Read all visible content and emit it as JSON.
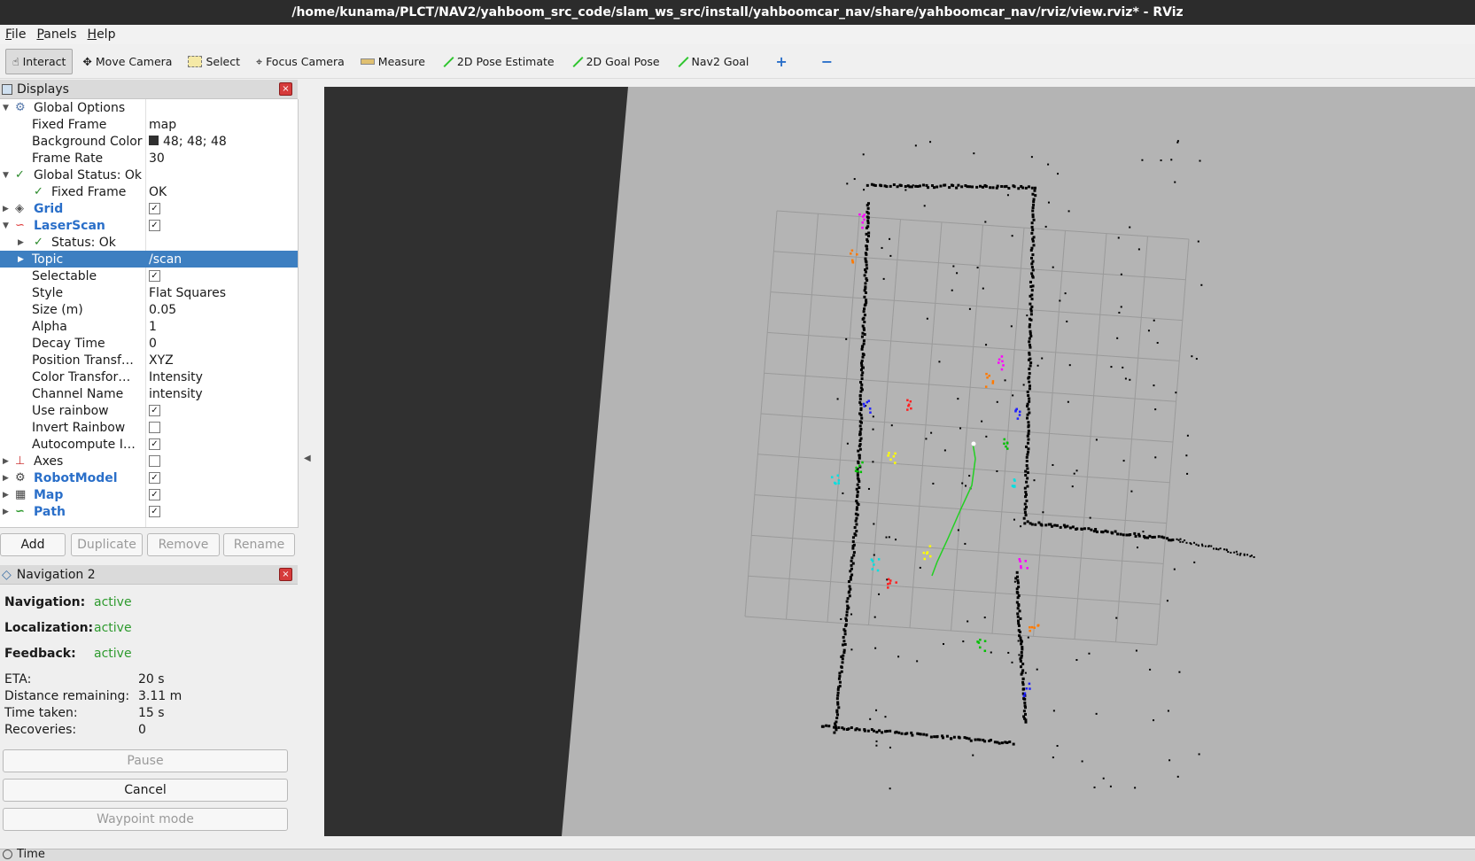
{
  "window": {
    "title": "/home/kunama/PLCT/NAV2/yahboom_src_code/slam_ws_src/install/yahboomcar_nav/share/yahboomcar_nav/rviz/view.rviz* - RViz"
  },
  "menu": [
    "File",
    "Panels",
    "Help"
  ],
  "toolbar": {
    "interact": "Interact",
    "move_camera": "Move Camera",
    "select": "Select",
    "focus_camera": "Focus Camera",
    "measure": "Measure",
    "pose_estimate": "2D Pose Estimate",
    "goal_pose": "2D Goal Pose",
    "nav2_goal": "Nav2 Goal"
  },
  "displays": {
    "title": "Displays",
    "rows": [
      {
        "label": "Global Options",
        "value": ""
      },
      {
        "label": "Fixed Frame",
        "value": "map"
      },
      {
        "label": "Background Color",
        "value": "48; 48; 48"
      },
      {
        "label": "Frame Rate",
        "value": "30"
      },
      {
        "label": "Global Status: Ok",
        "value": ""
      },
      {
        "label": "Fixed Frame",
        "value": "OK"
      },
      {
        "label": "Grid",
        "value": ""
      },
      {
        "label": "LaserScan",
        "value": ""
      },
      {
        "label": "Status: Ok",
        "value": ""
      },
      {
        "label": "Topic",
        "value": "/scan"
      },
      {
        "label": "Selectable",
        "value": ""
      },
      {
        "label": "Style",
        "value": "Flat Squares"
      },
      {
        "label": "Size (m)",
        "value": "0.05"
      },
      {
        "label": "Alpha",
        "value": "1"
      },
      {
        "label": "Decay Time",
        "value": "0"
      },
      {
        "label": "Position Transf…",
        "value": "XYZ"
      },
      {
        "label": "Color Transfor…",
        "value": "Intensity"
      },
      {
        "label": "Channel Name",
        "value": "intensity"
      },
      {
        "label": "Use rainbow",
        "value": ""
      },
      {
        "label": "Invert Rainbow",
        "value": ""
      },
      {
        "label": "Autocompute I…",
        "value": ""
      },
      {
        "label": "Axes",
        "value": ""
      },
      {
        "label": "RobotModel",
        "value": ""
      },
      {
        "label": "Map",
        "value": ""
      },
      {
        "label": "Path",
        "value": ""
      }
    ],
    "buttons": {
      "add": "Add",
      "duplicate": "Duplicate",
      "remove": "Remove",
      "rename": "Rename"
    }
  },
  "nav2": {
    "title": "Navigation 2",
    "navigation_label": "Navigation:",
    "navigation_value": "active",
    "localization_label": "Localization:",
    "localization_value": "active",
    "feedback_label": "Feedback:",
    "feedback_value": "active",
    "eta_label": "ETA:",
    "eta_value": "20 s",
    "distance_label": "Distance remaining:",
    "distance_value": "3.11 m",
    "time_label": "Time taken:",
    "time_value": "15 s",
    "recoveries_label": "Recoveries:",
    "recoveries_value": "0",
    "pause": "Pause",
    "cancel": "Cancel",
    "waypoint": "Waypoint mode"
  },
  "bottom": {
    "time_label": "Time"
  }
}
